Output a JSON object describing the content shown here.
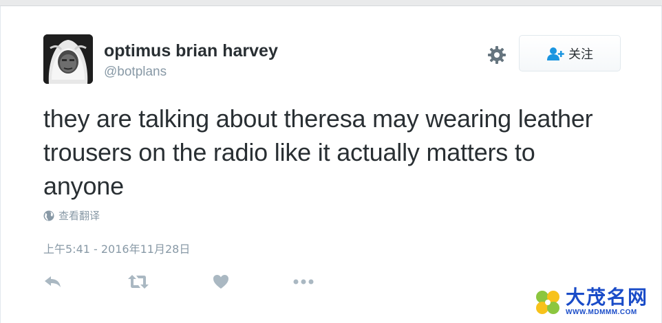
{
  "tweet": {
    "author": {
      "display_name": "optimus brian harvey",
      "handle": "@botplans",
      "avatar_icon": "avatar-photo"
    },
    "actions_top": {
      "settings_icon": "gear-icon",
      "follow_icon": "add-user-icon",
      "follow_label": "关注"
    },
    "text": "they are talking about theresa may wearing leather trousers on the radio like it actually matters to anyone",
    "translate": {
      "icon": "globe-icon",
      "label": "查看翻译"
    },
    "timestamp": "上午5:41 - 2016年11月28日",
    "footer_actions": [
      {
        "name": "reply",
        "icon": "reply-icon"
      },
      {
        "name": "retweet",
        "icon": "retweet-icon"
      },
      {
        "name": "like",
        "icon": "heart-icon"
      },
      {
        "name": "more",
        "icon": "more-icon"
      }
    ]
  },
  "watermark": {
    "name": "大茂名网",
    "url": "WWW.MDMMM.COM",
    "icon": "clover-logo"
  },
  "colors": {
    "text_primary": "#292f33",
    "text_secondary": "#8899a6",
    "icon_gray": "#aab8c2",
    "accent_blue": "#1b95e0",
    "watermark_blue": "#1a4cc8"
  }
}
